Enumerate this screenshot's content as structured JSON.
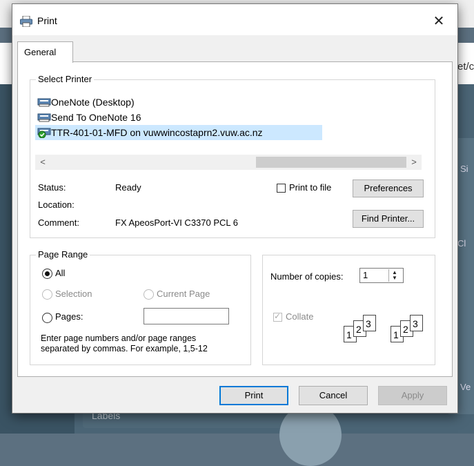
{
  "background": {
    "url_fragment": "et/c",
    "side_fragment_1": "Si",
    "side_fragment_2": "Cl",
    "side_fragment_3": "Ve",
    "bottom_label": "Labels"
  },
  "dialog": {
    "title": "Print",
    "close_glyph": "✕"
  },
  "tabs": [
    {
      "label": "General"
    }
  ],
  "select_printer": {
    "legend": "Select Printer",
    "printers": [
      {
        "label": "OneNote (Desktop)",
        "selected": false
      },
      {
        "label": "Send To OneNote 16",
        "selected": false
      },
      {
        "label": "TTR-401-01-MFD on vuwwincostaprn2.vuw.ac.nz",
        "selected": true
      }
    ],
    "scroll_left": "<",
    "scroll_right": ">",
    "status_label": "Status:",
    "status_value": "Ready",
    "location_label": "Location:",
    "location_value": "",
    "comment_label": "Comment:",
    "comment_value": "FX ApeosPort-VI C3370 PCL 6",
    "print_to_file_label": "Print to file",
    "preferences_label": "Preferences",
    "find_printer_label": "Find Printer..."
  },
  "page_range": {
    "legend": "Page Range",
    "all_label": "All",
    "selection_label": "Selection",
    "current_page_label": "Current Page",
    "pages_label": "Pages:",
    "pages_value": "",
    "help_line1": "Enter page numbers and/or page ranges",
    "help_line2": "separated by commas.  For example, 1,5-12"
  },
  "copies": {
    "label": "Number of copies:",
    "value": "1",
    "collate_label": "Collate",
    "collate_pages": [
      "1",
      "2",
      "3"
    ]
  },
  "buttons": {
    "print": "Print",
    "cancel": "Cancel",
    "apply": "Apply"
  },
  "colors": {
    "selection": "#cce8ff",
    "default_button_border": "#0078d7"
  }
}
